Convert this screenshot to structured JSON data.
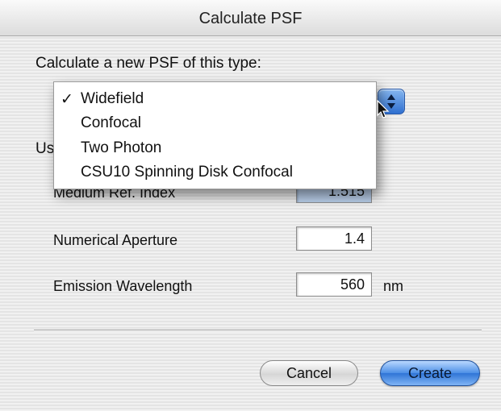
{
  "window": {
    "title": "Calculate PSF"
  },
  "prompt": "Calculate a new PSF of this type:",
  "psf_type": {
    "selected": "Widefield",
    "options": [
      "Widefield",
      "Confocal",
      "Two Photon",
      "CSU10 Spinning Disk Confocal"
    ],
    "check_mark": "✓"
  },
  "params_label_visible": "Us",
  "fields": {
    "medium_ref_index": {
      "label": "Medium Ref. Index",
      "value": "1.515"
    },
    "numerical_aperture": {
      "label": "Numerical Aperture",
      "value": "1.4"
    },
    "emission_wavelength": {
      "label": "Emission Wavelength",
      "value": "560",
      "unit": "nm"
    }
  },
  "buttons": {
    "cancel": "Cancel",
    "create": "Create"
  },
  "colors": {
    "accent": "#3a7ddb",
    "selection": "#b8cde8"
  },
  "icons": [
    "select-arrows-icon",
    "cursor-icon",
    "checkmark-icon"
  ]
}
